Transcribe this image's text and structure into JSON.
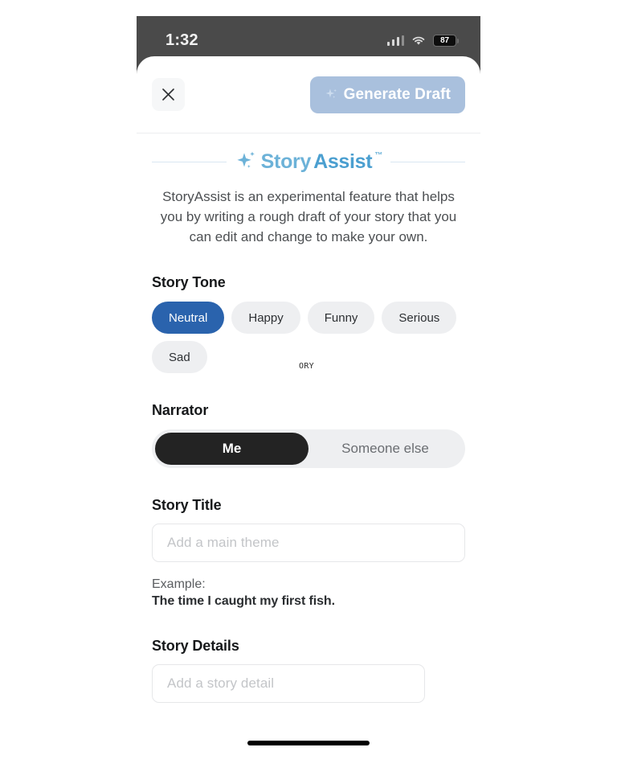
{
  "status_bar": {
    "time": "1:32",
    "battery_percent": "87",
    "signal_icon": "cellular-signal-icon",
    "wifi_icon": "wifi-icon",
    "battery_icon": "battery-icon"
  },
  "header": {
    "close_icon": "close-icon",
    "generate_label": "Generate Draft",
    "generate_icon": "sparkle-icon",
    "generate_bg": "#a9c0dd"
  },
  "brand": {
    "mark_icon": "sparkle-icon",
    "name_part1": "Story",
    "name_part2": "Assist",
    "trademark": "™",
    "color_light": "#6cb2d8",
    "color_dark": "#4b9fd0"
  },
  "intro": {
    "text": "StoryAssist is an experimental feature that helps you by writing a rough draft of your story that you can edit and change to make your own."
  },
  "story_tone": {
    "title": "Story Tone",
    "selected": "Neutral",
    "selected_color": "#2a63ad",
    "options": [
      "Neutral",
      "Happy",
      "Funny",
      "Serious",
      "Sad"
    ],
    "artifact_text": "ORY"
  },
  "narrator": {
    "title": "Narrator",
    "selected": "Me",
    "options": [
      "Me",
      "Someone else"
    ]
  },
  "story_title": {
    "title": "Story Title",
    "value": "",
    "placeholder": "Add a main theme",
    "example_label": "Example:",
    "example_text": "The time I caught my first fish."
  },
  "story_details": {
    "title": "Story Details",
    "value": "",
    "placeholder": "Add a story detail"
  }
}
